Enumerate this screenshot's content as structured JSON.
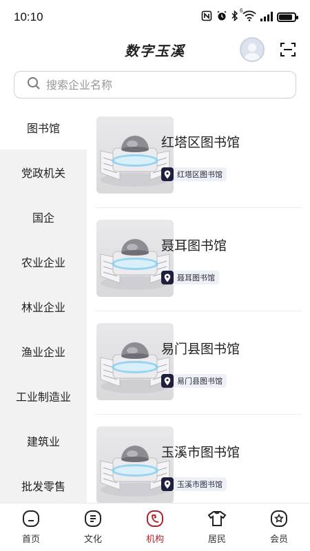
{
  "status_bar": {
    "time": "10:10",
    "icons": [
      "nfc-icon",
      "alarm-icon",
      "bluetooth-icon",
      "wifi-icon",
      "signal-icon",
      "battery-icon"
    ],
    "wifi_badge": "6",
    "battery_level": 0.85
  },
  "header": {
    "title": "数字玉溪",
    "avatar_icon": "user-avatar-icon",
    "scan_icon": "scan-icon"
  },
  "search": {
    "placeholder": "搜索企业名称",
    "value": ""
  },
  "sidebar": {
    "items": [
      {
        "label": "图书馆",
        "active": true
      },
      {
        "label": "党政机关",
        "active": false
      },
      {
        "label": "国企",
        "active": false
      },
      {
        "label": "农业企业",
        "active": false
      },
      {
        "label": "林业企业",
        "active": false
      },
      {
        "label": "渔业企业",
        "active": false
      },
      {
        "label": "工业制造业",
        "active": false
      },
      {
        "label": "建筑业",
        "active": false
      },
      {
        "label": "批发零售",
        "active": false
      }
    ]
  },
  "list": {
    "items": [
      {
        "title": "红塔区图书馆",
        "tag": "红塔区图书馆",
        "tag_icon": "location-pin-icon"
      },
      {
        "title": "聂耳图书馆",
        "tag": "聂耳图书馆",
        "tag_icon": "location-pin-icon"
      },
      {
        "title": "易门县图书馆",
        "tag": "易门县图书馆",
        "tag_icon": "location-pin-icon"
      },
      {
        "title": "玉溪市图书馆",
        "tag": "玉溪市图书馆",
        "tag_icon": "location-pin-icon"
      }
    ]
  },
  "tabbar": {
    "items": [
      {
        "label": "首页",
        "icon": "home-icon",
        "active": false
      },
      {
        "label": "文化",
        "icon": "culture-icon",
        "active": false
      },
      {
        "label": "机构",
        "icon": "institution-icon",
        "active": true
      },
      {
        "label": "居民",
        "icon": "resident-icon",
        "active": false
      },
      {
        "label": "会员",
        "icon": "member-icon",
        "active": false
      }
    ]
  },
  "colors": {
    "accent": "#b3232a",
    "sidebar_bg": "#f2f2f2",
    "tag_bg": "#eef0f8",
    "tag_icon_bg": "#1f1f3d"
  }
}
